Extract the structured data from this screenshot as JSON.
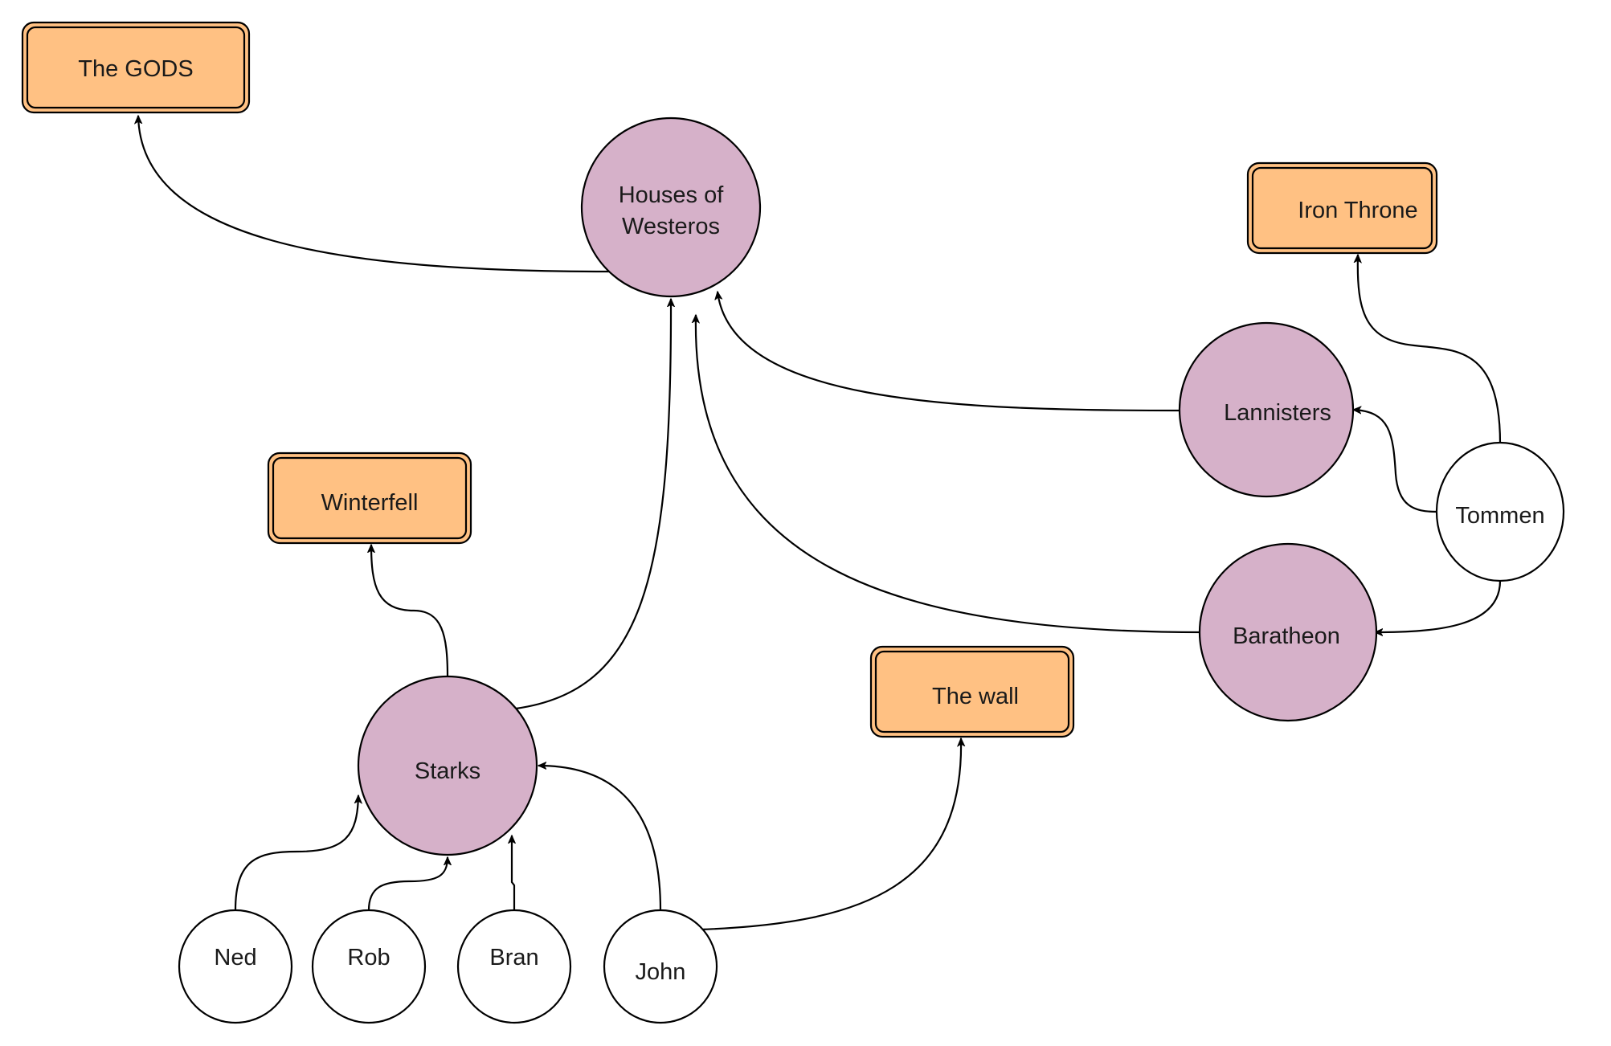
{
  "diagram": {
    "colors": {
      "house": "#d6b1c9",
      "place": "#ffc183",
      "person": "#ffffff",
      "stroke": "#000000"
    },
    "nodes": [
      {
        "id": "gods",
        "label": "The GODS",
        "kind": "place"
      },
      {
        "id": "houses",
        "label": "Houses of Westeros",
        "lines": [
          "Houses of",
          "Westeros"
        ],
        "kind": "house"
      },
      {
        "id": "iron-throne",
        "label": "Iron Throne",
        "kind": "place"
      },
      {
        "id": "lannisters",
        "label": "Lannisters",
        "kind": "house"
      },
      {
        "id": "tommen",
        "label": "Tommen",
        "kind": "person"
      },
      {
        "id": "baratheon",
        "label": "Baratheon",
        "kind": "house"
      },
      {
        "id": "winterfell",
        "label": "Winterfell",
        "kind": "place"
      },
      {
        "id": "starks",
        "label": "Starks",
        "kind": "house"
      },
      {
        "id": "the-wall",
        "label": "The wall",
        "kind": "place"
      },
      {
        "id": "ned",
        "label": "Ned",
        "kind": "person"
      },
      {
        "id": "rob",
        "label": "Rob",
        "kind": "person"
      },
      {
        "id": "bran",
        "label": "Bran",
        "kind": "person"
      },
      {
        "id": "john",
        "label": "John",
        "kind": "person"
      }
    ],
    "edges": [
      {
        "from": "houses",
        "to": "gods"
      },
      {
        "from": "starks",
        "to": "houses"
      },
      {
        "from": "baratheon",
        "to": "houses"
      },
      {
        "from": "lannisters",
        "to": "houses"
      },
      {
        "from": "tommen",
        "to": "iron-throne"
      },
      {
        "from": "tommen",
        "to": "lannisters"
      },
      {
        "from": "tommen",
        "to": "baratheon"
      },
      {
        "from": "starks",
        "to": "winterfell"
      },
      {
        "from": "ned",
        "to": "starks"
      },
      {
        "from": "rob",
        "to": "starks"
      },
      {
        "from": "bran",
        "to": "starks"
      },
      {
        "from": "john",
        "to": "starks"
      },
      {
        "from": "john",
        "to": "the-wall"
      }
    ]
  }
}
